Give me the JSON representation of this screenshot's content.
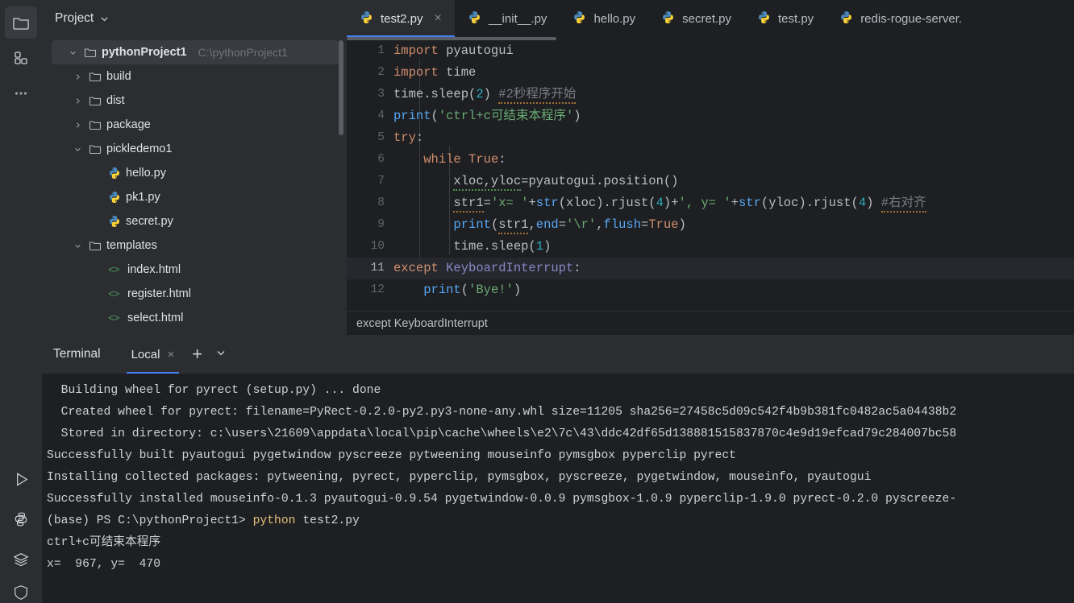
{
  "activitybar": {
    "top_items": [
      {
        "name": "project-folder-icon",
        "label": "Project",
        "selected": true
      },
      {
        "name": "structure-icon",
        "label": "Structure",
        "selected": false
      },
      {
        "name": "more-tool-windows-icon",
        "label": "More tool windows",
        "selected": false
      }
    ],
    "bottom_items": [
      {
        "name": "run-icon",
        "label": "Run"
      },
      {
        "name": "python-console-icon",
        "label": "Python Console"
      },
      {
        "name": "services-icon",
        "label": "Services"
      },
      {
        "name": "problems-icon",
        "label": "Problems"
      }
    ]
  },
  "project": {
    "title": "Project",
    "tree": [
      {
        "name": "pythonProject1",
        "hint": "C:\\pythonProject1",
        "type": "folder",
        "indent": 0,
        "arrow": "down",
        "selected": true,
        "bold": true
      },
      {
        "name": "build",
        "hint": "",
        "type": "folder",
        "indent": 1,
        "arrow": "right",
        "selected": false,
        "bold": false
      },
      {
        "name": "dist",
        "hint": "",
        "type": "folder",
        "indent": 1,
        "arrow": "right",
        "selected": false,
        "bold": false
      },
      {
        "name": "package",
        "hint": "",
        "type": "folder",
        "indent": 1,
        "arrow": "right",
        "selected": false,
        "bold": false
      },
      {
        "name": "pickledemo1",
        "hint": "",
        "type": "folder",
        "indent": 1,
        "arrow": "down",
        "selected": false,
        "bold": false
      },
      {
        "name": "hello.py",
        "hint": "",
        "type": "python",
        "indent": 2,
        "arrow": "none",
        "selected": false,
        "bold": false
      },
      {
        "name": "pk1.py",
        "hint": "",
        "type": "python",
        "indent": 2,
        "arrow": "none",
        "selected": false,
        "bold": false
      },
      {
        "name": "secret.py",
        "hint": "",
        "type": "python",
        "indent": 2,
        "arrow": "none",
        "selected": false,
        "bold": false
      },
      {
        "name": "templates",
        "hint": "",
        "type": "folder",
        "indent": 1,
        "arrow": "down",
        "selected": false,
        "bold": false
      },
      {
        "name": "index.html",
        "hint": "",
        "type": "html",
        "indent": 2,
        "arrow": "none",
        "selected": false,
        "bold": false
      },
      {
        "name": "register.html",
        "hint": "",
        "type": "html",
        "indent": 2,
        "arrow": "none",
        "selected": false,
        "bold": false
      },
      {
        "name": "select.html",
        "hint": "",
        "type": "html",
        "indent": 2,
        "arrow": "none",
        "selected": false,
        "bold": false
      }
    ]
  },
  "editor": {
    "tabs": [
      {
        "label": "test2.py",
        "icon": "python-file-icon",
        "active": true,
        "closable": true
      },
      {
        "label": "__init__.py",
        "icon": "python-file-icon",
        "active": false,
        "closable": false
      },
      {
        "label": "hello.py",
        "icon": "python-file-icon",
        "active": false,
        "closable": false
      },
      {
        "label": "secret.py",
        "icon": "python-file-icon",
        "active": false,
        "closable": false
      },
      {
        "label": "test.py",
        "icon": "python-file-icon",
        "active": false,
        "closable": false
      },
      {
        "label": "redis-rogue-server.",
        "icon": "python-file-icon",
        "active": false,
        "closable": false
      }
    ],
    "line_numbers": [
      "1",
      "2",
      "3",
      "4",
      "5",
      "6",
      "7",
      "8",
      "9",
      "10",
      "11",
      "12"
    ],
    "current_line": 11,
    "breadcrumb": "except KeyboardInterrupt",
    "lines": [
      {
        "n": 1,
        "plain": "import pyautogui"
      },
      {
        "n": 2,
        "plain": "import time"
      },
      {
        "n": 3,
        "plain": "time.sleep(2) #2秒程序开始"
      },
      {
        "n": 4,
        "plain": "print('ctrl+c可结束本程序')"
      },
      {
        "n": 5,
        "plain": "try:"
      },
      {
        "n": 6,
        "plain": "    while True:"
      },
      {
        "n": 7,
        "plain": "        xloc,yloc=pyautogui.position()"
      },
      {
        "n": 8,
        "plain": "        str1='x= '+str(xloc).rjust(4)+', y= '+str(yloc).rjust(4) #右对齐"
      },
      {
        "n": 9,
        "plain": "        print(str1,end='\\r',flush=True)"
      },
      {
        "n": 10,
        "plain": "        time.sleep(1)"
      },
      {
        "n": 11,
        "plain": "except KeyboardInterrupt:"
      },
      {
        "n": 12,
        "plain": "    print('Bye!')"
      }
    ],
    "tokens": {
      "l1_kw": "import",
      "l1_mod": " pyautogui",
      "l2_kw": "import",
      "l2_mod": " time",
      "l3_a": "time.sleep(",
      "l3_num": "2",
      "l3_b": ")",
      "l3_cmt": "#2秒程序开始",
      "l4_fn": "print",
      "l4_p1": "(",
      "l4_str": "'ctrl+c可结束本程序'",
      "l4_p2": ")",
      "l5_kw": "try",
      "l5_colon": ":",
      "l6_kw": "while",
      "l6_true": " True",
      "l6_colon": ":",
      "l7_ids": "xloc,yloc",
      "l7_rest": "=pyautogui.position()",
      "l8_var": "str1",
      "l8_eq": "=",
      "l8_s1": "'x= '",
      "l8_plus1": "+",
      "l8_str": "str",
      "l8_a": "(xloc).rjust(",
      "l8_n1": "4",
      "l8_b": ")",
      "l8_plus2": "+",
      "l8_s2": "', y= '",
      "l8_plus3": "+",
      "l8_str2": "str",
      "l8_c": "(yloc).rjust(",
      "l8_n2": "4",
      "l8_d": ")",
      "l8_cmt": "#右对齐",
      "l9_fn": "print",
      "l9_p1": "(",
      "l9_var": "str1",
      "l9_comma": ",",
      "l9_kwarg": "end",
      "l9_eq": "=",
      "l9_str": "'\\r'",
      "l9_comma2": ",",
      "l9_kwarg2": "flush",
      "l9_eq2": "=",
      "l9_true": "True",
      "l9_p2": ")",
      "l10_a": "time.sleep(",
      "l10_num": "1",
      "l10_b": ")",
      "l11_kw": "except",
      "l11_cls": " KeyboardInterrupt",
      "l11_colon": ":",
      "l12_fn": "print",
      "l12_p1": "(",
      "l12_str": "'Bye!'",
      "l12_p2": ")"
    }
  },
  "terminal": {
    "title": "Terminal",
    "tab_label": "Local",
    "close_label": "×",
    "plus_label": "+",
    "lines": [
      {
        "text": "  Building wheel for pyrect (setup.py) ... done"
      },
      {
        "text": "  Created wheel for pyrect: filename=PyRect-0.2.0-py2.py3-none-any.whl size=11205 sha256=27458c5d09c542f4b9b381fc0482ac5a04438b2"
      },
      {
        "text": "  Stored in directory: c:\\users\\21609\\appdata\\local\\pip\\cache\\wheels\\e2\\7c\\43\\ddc42df65d138881515837870c4e9d19efcad79c284007bc58"
      },
      {
        "text": "Successfully built pyautogui pygetwindow pyscreeze pytweening mouseinfo pymsgbox pyperclip pyrect"
      },
      {
        "text": "Installing collected packages: pytweening, pyrect, pyperclip, pymsgbox, pyscreeze, pygetwindow, mouseinfo, pyautogui"
      },
      {
        "text": "Successfully installed mouseinfo-0.1.3 pyautogui-0.9.54 pygetwindow-0.0.9 pymsgbox-1.0.9 pyperclip-1.9.0 pyrect-0.2.0 pyscreeze-"
      }
    ],
    "prompt_prefix": "(base) PS C:\\pythonProject1> ",
    "prompt_command": "python",
    "prompt_args": " test2.py",
    "output_lines": [
      "ctrl+c可结束本程序",
      "x=  967, y=  470"
    ]
  },
  "colors": {
    "accent_blue": "#4682fa",
    "panel_bg": "#2b2d30",
    "editor_bg": "#1e1f22",
    "selection": "#393b40",
    "keyword": "#cf8e6d",
    "string": "#6aab73",
    "number": "#2aacb8",
    "comment": "#7a7e85",
    "function": "#56a8f5",
    "class_name": "#8888c6"
  }
}
